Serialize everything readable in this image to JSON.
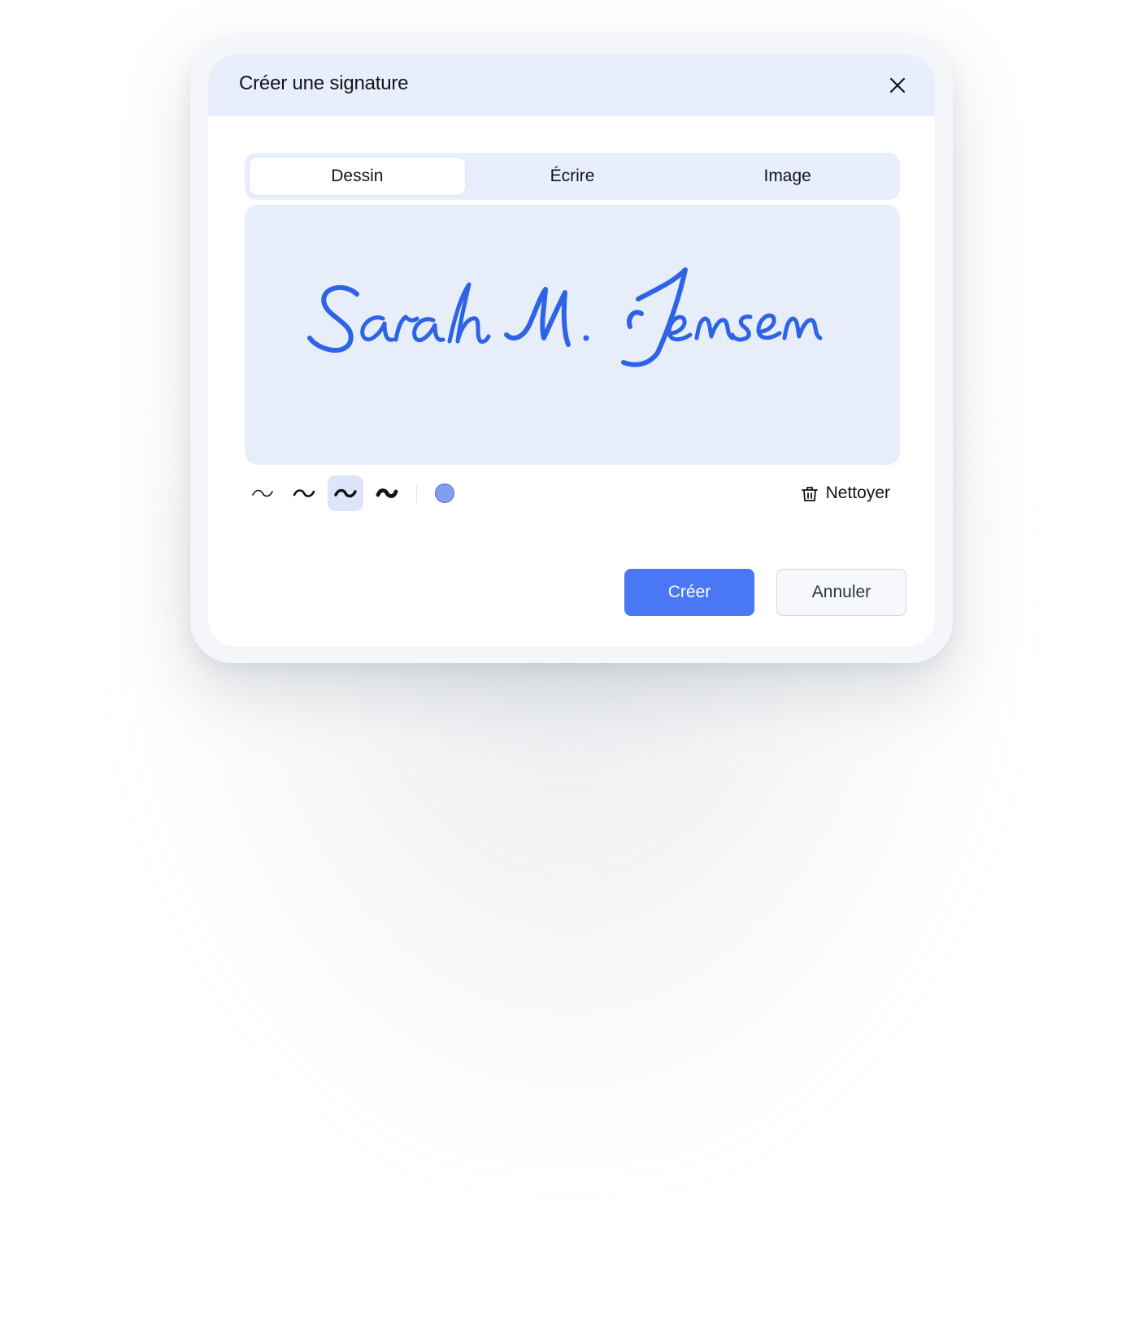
{
  "dialog": {
    "title": "Créer une signature",
    "close_icon": "close-icon"
  },
  "tabs": [
    {
      "label": "Dessin",
      "active": true
    },
    {
      "label": "Écrire",
      "active": false
    },
    {
      "label": "Image",
      "active": false
    }
  ],
  "canvas": {
    "signature_text": "Sarah M. Jensen",
    "ink_color": "#2d63e6",
    "background_color": "#e8edfa"
  },
  "toolbar": {
    "stroke_widths": [
      {
        "icon": "thin-stroke-icon",
        "selected": false
      },
      {
        "icon": "medium-stroke-icon",
        "selected": false
      },
      {
        "icon": "thick-stroke-icon",
        "selected": true
      },
      {
        "icon": "extra-thick-stroke-icon",
        "selected": false
      }
    ],
    "selected_color": "#7f9ff0",
    "clear_label": "Nettoyer",
    "clear_icon": "trash-icon"
  },
  "actions": {
    "create_label": "Créer",
    "cancel_label": "Annuler"
  },
  "colors": {
    "accent": "#4a78f5",
    "header_bg": "#e8eefb"
  }
}
